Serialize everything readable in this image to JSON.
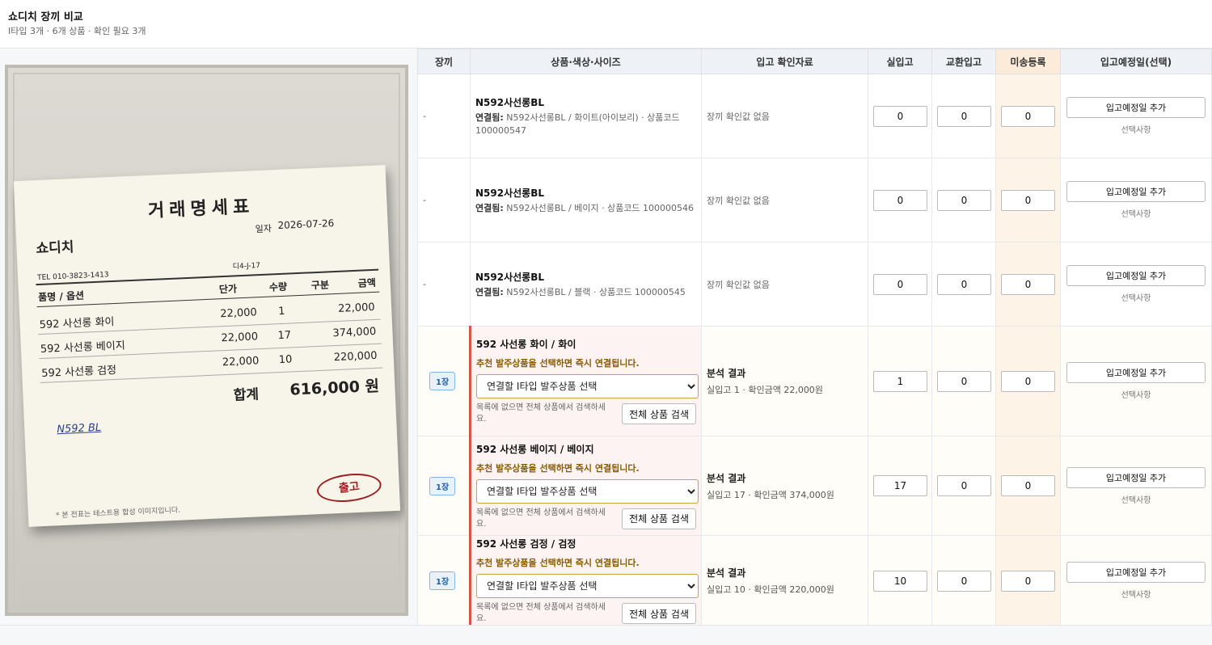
{
  "header": {
    "title": "쇼디치 장끼 비교",
    "subtitle": "I타입 3개 · 6개 상품 · 확인 필요 3개"
  },
  "receipt": {
    "title": "거래명세표",
    "shop": "쇼디치",
    "date_label": "일자",
    "date": "2026-07-26",
    "tel": "TEL 010-3823-1413",
    "code": "디4-J-17",
    "headers": {
      "item": "품명 / 옵션",
      "price": "단가",
      "qty": "수량",
      "type": "구분",
      "amount": "금액"
    },
    "items": [
      {
        "name": "592 사선롱  화이",
        "price": "22,000",
        "qty": "1",
        "amount": "22,000"
      },
      {
        "name": "592 사선롱  베이지",
        "price": "22,000",
        "qty": "17",
        "amount": "374,000"
      },
      {
        "name": "592 사선롱  검정",
        "price": "22,000",
        "qty": "10",
        "amount": "220,000"
      }
    ],
    "total_label": "합계",
    "total": "616,000 원",
    "note": "N592 BL",
    "stamp": "출고",
    "footer": "* 본 전표는 테스트용 합성 이미지입니다."
  },
  "table": {
    "headers": {
      "slip": "장끼",
      "product": "상품·색상·사이즈",
      "evidence": "입고 확인자료",
      "actual": "실입고",
      "exchange": "교환입고",
      "unsent": "미송등록",
      "schedule": "입고예정일(선택)"
    },
    "linked_label": "연결됨:",
    "add_date_label": "입고예정일 추가",
    "optional_label": "선택사항",
    "hint": "추천 발주상품을 선택하면 즉시 연결됩니다.",
    "select_placeholder": "연결할 I타입 발주상품 선택",
    "search_msg": "목록에 없으면 전체 상품에서 검색하세요.",
    "search_button": "전체 상품 검색",
    "analysis_title": "분석 결과",
    "no_value": "장끼 확인값 없음",
    "rows_linked": [
      {
        "slip": "-",
        "name": "N592사선롱BL",
        "detail": "N592사선롱BL / 화이트(아이보리) · 상품코드 100000547",
        "actual": "0",
        "exchange": "0",
        "unsent": "0"
      },
      {
        "slip": "-",
        "name": "N592사선롱BL",
        "detail": "N592사선롱BL / 베이지 · 상품코드 100000546",
        "actual": "0",
        "exchange": "0",
        "unsent": "0"
      },
      {
        "slip": "-",
        "name": "N592사선롱BL",
        "detail": "N592사선롱BL / 블랙 · 상품코드 100000545",
        "actual": "0",
        "exchange": "0",
        "unsent": "0"
      }
    ],
    "rows_pending": [
      {
        "badge": "1장",
        "name": "592 사선롱 화이 / 화이",
        "analysis": "실입고 1 · 확인금액 22,000원",
        "actual": "1",
        "exchange": "0",
        "unsent": "0"
      },
      {
        "badge": "1장",
        "name": "592 사선롱 베이지 / 베이지",
        "analysis": "실입고 17 · 확인금액 374,000원",
        "actual": "17",
        "exchange": "0",
        "unsent": "0"
      },
      {
        "badge": "1장",
        "name": "592 사선롱 검정 / 검정",
        "analysis": "실입고 10 · 확인금액 220,000원",
        "actual": "10",
        "exchange": "0",
        "unsent": "0"
      }
    ]
  }
}
